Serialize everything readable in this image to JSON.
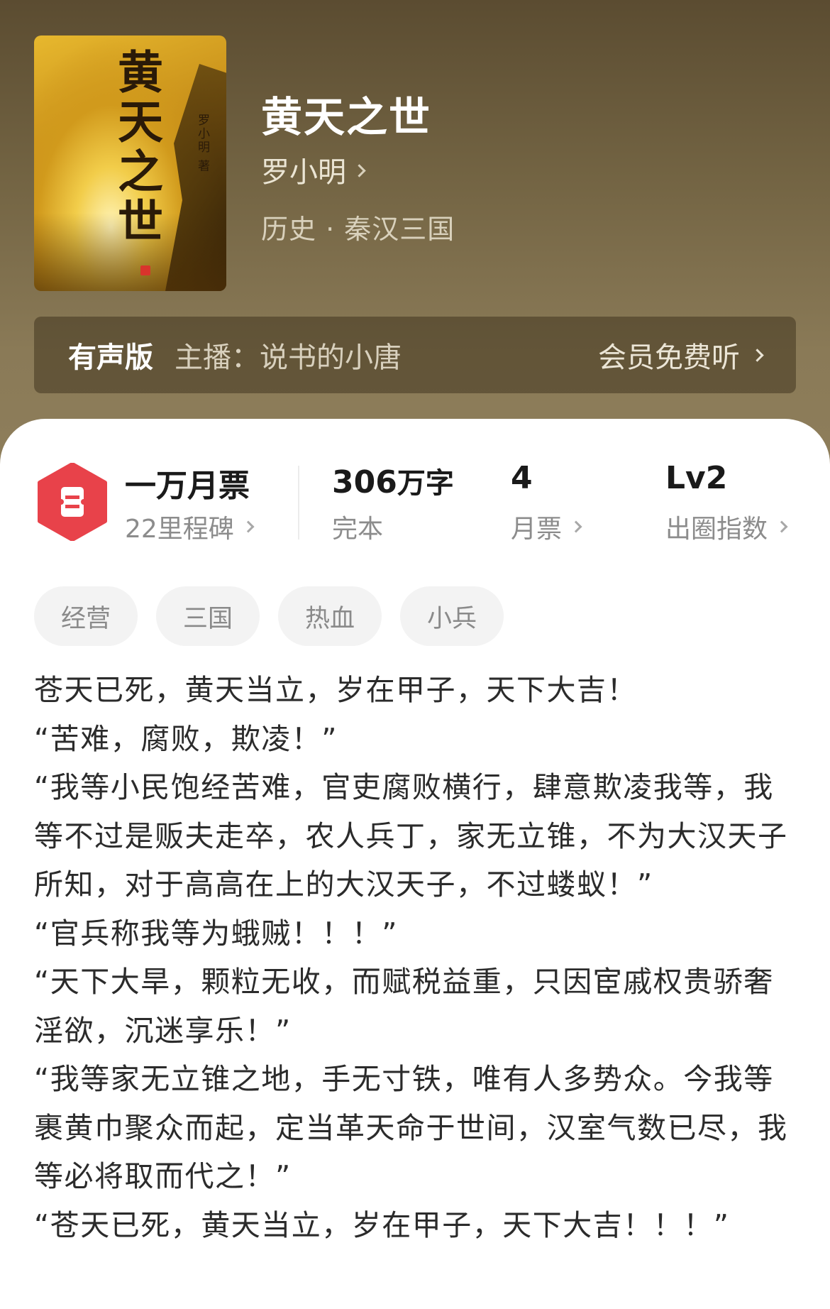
{
  "book": {
    "title": "黄天之世",
    "author": "罗小明",
    "genre": "历史 · 秦汉三国",
    "cover": {
      "title": "黄天之世",
      "author_text": "罗小明 著"
    }
  },
  "audio": {
    "label": "有声版",
    "host": "主播：说书的小唐",
    "action": "会员免费听"
  },
  "stats": {
    "monthly": {
      "title": "一万月票",
      "milestone": "22里程碑"
    },
    "words": {
      "value": "306",
      "unit": "万字",
      "status": "完本"
    },
    "tickets": {
      "value": "4",
      "label": "月票"
    },
    "level": {
      "value": "Lv2",
      "label": "出圈指数"
    }
  },
  "tags": [
    "经营",
    "三国",
    "热血",
    "小兵"
  ],
  "synopsis": [
    "苍天已死，黄天当立，岁在甲子，天下大吉！",
    "“苦难，腐败，欺凌！”",
    "“我等小民饱经苦难，官吏腐败横行，肆意欺凌我等，我等不过是贩夫走卒，农人兵丁，家无立锥，不为大汉天子所知，对于高高在上的大汉天子，不过蝼蚁！”",
    "“官兵称我等为蛾贼！！！”",
    "“天下大旱，颗粒无收，而赋税益重，只因宦戚权贵骄奢淫欲，沉迷享乐！”",
    "“我等家无立锥之地，手无寸铁，唯有人多势众。今我等裹黄巾聚众而起，定当革天命于世间，汉室气数已尽，我等必将取而代之！”",
    "“苍天已死，黄天当立，岁在甲子，天下大吉！！！”"
  ],
  "colors": {
    "header_top": "#5b4c31",
    "header_bottom": "#8e7e5b",
    "ticket_icon": "#e8424a"
  },
  "icons": [
    "ticket-icon",
    "chevron-right-icon"
  ]
}
